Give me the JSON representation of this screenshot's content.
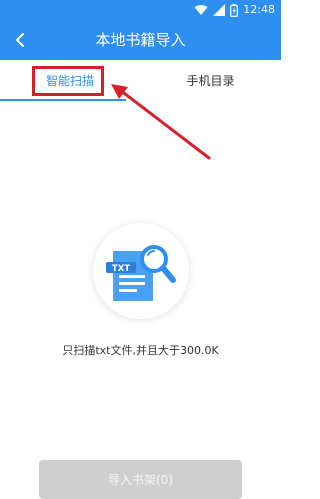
{
  "status_bar": {
    "time": "12:48"
  },
  "header": {
    "title": "本地书籍导入"
  },
  "tabs": [
    {
      "label": "智能扫描"
    },
    {
      "label": "手机目录"
    }
  ],
  "empty_state": {
    "icon_badge": "TXT",
    "description": "只扫描txt文件,并且大于300.0K"
  },
  "import_button": {
    "label": "导入书架(0)"
  },
  "colors": {
    "accent": "#2f8ff0",
    "annotation": "#d9202a",
    "button_disabled": "#cfcfcf"
  },
  "icons": [
    "back-arrow-icon",
    "wifi-icon",
    "signal-icon",
    "battery-icon",
    "txt-file-search-icon"
  ]
}
